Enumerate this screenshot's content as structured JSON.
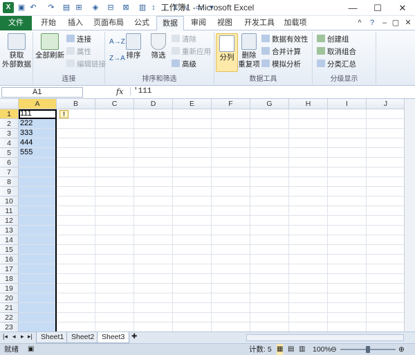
{
  "title_bar": {
    "title": "工作簿1 - Microsoft Excel",
    "minimize_icon": "minimize-icon",
    "maximize_icon": "maximize-icon",
    "close_icon": "close-icon"
  },
  "tabs": [
    "文件",
    "开始",
    "插入",
    "页面布局",
    "公式",
    "数据",
    "审阅",
    "视图",
    "开发工具",
    "加载项"
  ],
  "active_tab": "数据",
  "ribbon": {
    "get_external": "获取\n外部数据",
    "refresh_all": "全部刷新",
    "connections": "连接",
    "properties": "属性",
    "edit_links": "编辑链接",
    "group_connections": "连接",
    "sort_az": "A→Z",
    "sort_za": "Z→A",
    "sort": "排序",
    "filter": "筛选",
    "clear": "清除",
    "reapply": "重新应用",
    "advanced": "高级",
    "group_sort": "排序和筛选",
    "text_to_columns": "分列",
    "remove_dup": "删除\n重复项",
    "data_validation": "数据有效性",
    "consolidate": "合并计算",
    "what_if": "模拟分析",
    "group_tools": "数据工具",
    "group_create": "创建组",
    "ungroup": "取消组合",
    "subtotal": "分类汇总",
    "group_outline": "分级显示"
  },
  "formula_bar": {
    "name_box": "A1",
    "fx": "fx",
    "formula": "'111"
  },
  "columns": [
    "A",
    "B",
    "C",
    "D",
    "E",
    "F",
    "G",
    "H",
    "I",
    "J"
  ],
  "rows": [
    "1",
    "2",
    "3",
    "4",
    "5",
    "6",
    "7",
    "8",
    "9",
    "10",
    "11",
    "12",
    "13",
    "14",
    "15",
    "16",
    "17",
    "18",
    "19",
    "20",
    "21",
    "22",
    "23"
  ],
  "cells_A": [
    "111",
    "222",
    "333",
    "444",
    "555"
  ],
  "sheets": [
    "Sheet1",
    "Sheet2",
    "Sheet3"
  ],
  "active_sheet": "Sheet3",
  "status": {
    "mode": "就绪",
    "count": "计数: 5",
    "zoom": "100%",
    "zoom_level": 100
  },
  "colors": {
    "file_tab": "#1d7a3e",
    "selection": "#c6dcf5",
    "header_highlight": "#f7d86b"
  }
}
